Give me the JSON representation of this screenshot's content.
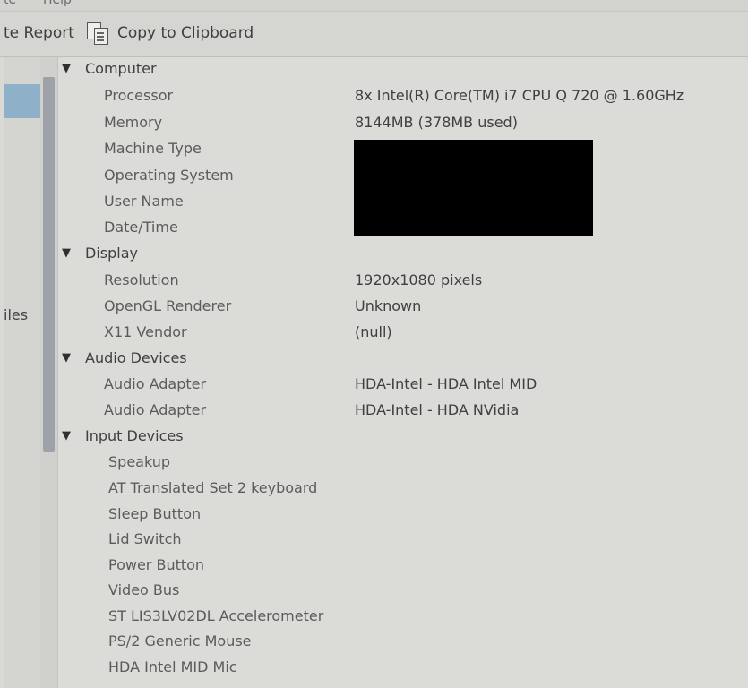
{
  "menubar": {
    "items": [
      "te",
      "Help"
    ]
  },
  "toolbar": {
    "generate_report_label": "te Report",
    "copy_clipboard_label": "Copy to Clipboard"
  },
  "sidebar": {
    "partial_label": "iles"
  },
  "tree": {
    "computer": {
      "label": "Computer",
      "items": [
        {
          "name": "Processor",
          "value": "8x Intel(R) Core(TM) i7 CPU      Q 720  @ 1.60GHz"
        },
        {
          "name": "Memory",
          "value": "8144MB (378MB used)"
        },
        {
          "name": "Machine Type",
          "value": ""
        },
        {
          "name": "Operating System",
          "value": ""
        },
        {
          "name": "User Name",
          "value": ""
        },
        {
          "name": "Date/Time",
          "value": ""
        }
      ]
    },
    "display": {
      "label": "Display",
      "items": [
        {
          "name": "Resolution",
          "value": "1920x1080 pixels"
        },
        {
          "name": "OpenGL Renderer",
          "value": "Unknown"
        },
        {
          "name": "X11 Vendor",
          "value": "(null)"
        }
      ]
    },
    "audio": {
      "label": "Audio Devices",
      "items": [
        {
          "name": "Audio Adapter",
          "value": "HDA-Intel - HDA Intel MID"
        },
        {
          "name": "Audio Adapter",
          "value": "HDA-Intel - HDA NVidia"
        }
      ]
    },
    "input": {
      "label": "Input Devices",
      "items": [
        "Speakup",
        "AT Translated Set 2 keyboard",
        "Sleep Button",
        "Lid Switch",
        "Power Button",
        "Video Bus",
        "ST LIS3LV02DL Accelerometer",
        "PS/2 Generic Mouse",
        "HDA Intel MID Mic"
      ]
    }
  }
}
